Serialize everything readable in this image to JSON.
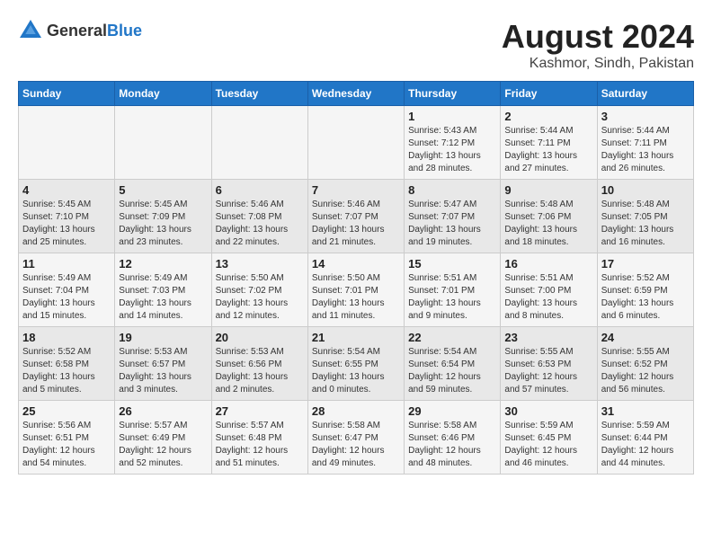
{
  "header": {
    "logo_general": "General",
    "logo_blue": "Blue",
    "month_year": "August 2024",
    "location": "Kashmor, Sindh, Pakistan"
  },
  "weekdays": [
    "Sunday",
    "Monday",
    "Tuesday",
    "Wednesday",
    "Thursday",
    "Friday",
    "Saturday"
  ],
  "weeks": [
    [
      {
        "day": "",
        "info": ""
      },
      {
        "day": "",
        "info": ""
      },
      {
        "day": "",
        "info": ""
      },
      {
        "day": "",
        "info": ""
      },
      {
        "day": "1",
        "info": "Sunrise: 5:43 AM\nSunset: 7:12 PM\nDaylight: 13 hours\nand 28 minutes."
      },
      {
        "day": "2",
        "info": "Sunrise: 5:44 AM\nSunset: 7:11 PM\nDaylight: 13 hours\nand 27 minutes."
      },
      {
        "day": "3",
        "info": "Sunrise: 5:44 AM\nSunset: 7:11 PM\nDaylight: 13 hours\nand 26 minutes."
      }
    ],
    [
      {
        "day": "4",
        "info": "Sunrise: 5:45 AM\nSunset: 7:10 PM\nDaylight: 13 hours\nand 25 minutes."
      },
      {
        "day": "5",
        "info": "Sunrise: 5:45 AM\nSunset: 7:09 PM\nDaylight: 13 hours\nand 23 minutes."
      },
      {
        "day": "6",
        "info": "Sunrise: 5:46 AM\nSunset: 7:08 PM\nDaylight: 13 hours\nand 22 minutes."
      },
      {
        "day": "7",
        "info": "Sunrise: 5:46 AM\nSunset: 7:07 PM\nDaylight: 13 hours\nand 21 minutes."
      },
      {
        "day": "8",
        "info": "Sunrise: 5:47 AM\nSunset: 7:07 PM\nDaylight: 13 hours\nand 19 minutes."
      },
      {
        "day": "9",
        "info": "Sunrise: 5:48 AM\nSunset: 7:06 PM\nDaylight: 13 hours\nand 18 minutes."
      },
      {
        "day": "10",
        "info": "Sunrise: 5:48 AM\nSunset: 7:05 PM\nDaylight: 13 hours\nand 16 minutes."
      }
    ],
    [
      {
        "day": "11",
        "info": "Sunrise: 5:49 AM\nSunset: 7:04 PM\nDaylight: 13 hours\nand 15 minutes."
      },
      {
        "day": "12",
        "info": "Sunrise: 5:49 AM\nSunset: 7:03 PM\nDaylight: 13 hours\nand 14 minutes."
      },
      {
        "day": "13",
        "info": "Sunrise: 5:50 AM\nSunset: 7:02 PM\nDaylight: 13 hours\nand 12 minutes."
      },
      {
        "day": "14",
        "info": "Sunrise: 5:50 AM\nSunset: 7:01 PM\nDaylight: 13 hours\nand 11 minutes."
      },
      {
        "day": "15",
        "info": "Sunrise: 5:51 AM\nSunset: 7:01 PM\nDaylight: 13 hours\nand 9 minutes."
      },
      {
        "day": "16",
        "info": "Sunrise: 5:51 AM\nSunset: 7:00 PM\nDaylight: 13 hours\nand 8 minutes."
      },
      {
        "day": "17",
        "info": "Sunrise: 5:52 AM\nSunset: 6:59 PM\nDaylight: 13 hours\nand 6 minutes."
      }
    ],
    [
      {
        "day": "18",
        "info": "Sunrise: 5:52 AM\nSunset: 6:58 PM\nDaylight: 13 hours\nand 5 minutes."
      },
      {
        "day": "19",
        "info": "Sunrise: 5:53 AM\nSunset: 6:57 PM\nDaylight: 13 hours\nand 3 minutes."
      },
      {
        "day": "20",
        "info": "Sunrise: 5:53 AM\nSunset: 6:56 PM\nDaylight: 13 hours\nand 2 minutes."
      },
      {
        "day": "21",
        "info": "Sunrise: 5:54 AM\nSunset: 6:55 PM\nDaylight: 13 hours\nand 0 minutes."
      },
      {
        "day": "22",
        "info": "Sunrise: 5:54 AM\nSunset: 6:54 PM\nDaylight: 12 hours\nand 59 minutes."
      },
      {
        "day": "23",
        "info": "Sunrise: 5:55 AM\nSunset: 6:53 PM\nDaylight: 12 hours\nand 57 minutes."
      },
      {
        "day": "24",
        "info": "Sunrise: 5:55 AM\nSunset: 6:52 PM\nDaylight: 12 hours\nand 56 minutes."
      }
    ],
    [
      {
        "day": "25",
        "info": "Sunrise: 5:56 AM\nSunset: 6:51 PM\nDaylight: 12 hours\nand 54 minutes."
      },
      {
        "day": "26",
        "info": "Sunrise: 5:57 AM\nSunset: 6:49 PM\nDaylight: 12 hours\nand 52 minutes."
      },
      {
        "day": "27",
        "info": "Sunrise: 5:57 AM\nSunset: 6:48 PM\nDaylight: 12 hours\nand 51 minutes."
      },
      {
        "day": "28",
        "info": "Sunrise: 5:58 AM\nSunset: 6:47 PM\nDaylight: 12 hours\nand 49 minutes."
      },
      {
        "day": "29",
        "info": "Sunrise: 5:58 AM\nSunset: 6:46 PM\nDaylight: 12 hours\nand 48 minutes."
      },
      {
        "day": "30",
        "info": "Sunrise: 5:59 AM\nSunset: 6:45 PM\nDaylight: 12 hours\nand 46 minutes."
      },
      {
        "day": "31",
        "info": "Sunrise: 5:59 AM\nSunset: 6:44 PM\nDaylight: 12 hours\nand 44 minutes."
      }
    ]
  ]
}
